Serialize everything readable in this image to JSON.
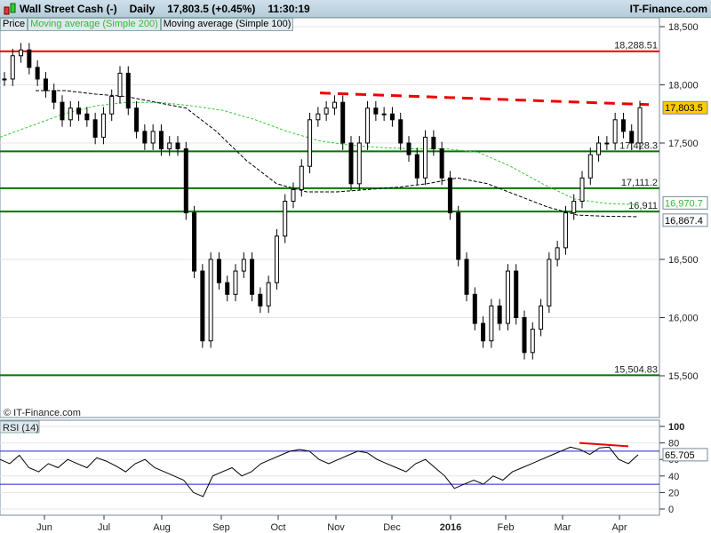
{
  "header": {
    "title": "Wall Street Cash (-)",
    "period": "Daily",
    "price": "17,803.5 (+0.45%)",
    "time": "11:30:19",
    "brand": "IT-Finance.com"
  },
  "legend": [
    "Price",
    "Moving average (Simple 200)",
    "Moving average (Simple 100)"
  ],
  "copyright": "© IT-Finance.com",
  "rsi_label": "RSI (14)",
  "colors": {
    "up": "#ffffff",
    "down": "#000000",
    "ma200": "#33cc33",
    "ma100": "#000000",
    "support": "#007700",
    "resistance": "#ee0000",
    "rsi_band": "#2222cc",
    "last": "#ffcc00"
  },
  "chart_data": [
    {
      "type": "candlestick",
      "title": "Wall Street Cash (-) Daily",
      "ylim": [
        15000,
        18600
      ],
      "yticks": [
        "18,500",
        "18,000",
        "17,500",
        "16,500",
        "16,000",
        "15,500"
      ],
      "ytick_values": [
        18500,
        18000,
        17500,
        16500,
        16000,
        15500
      ],
      "xticks": [
        "Jun",
        "Jul",
        "Aug",
        "Sep",
        "Oct",
        "Nov",
        "Dec",
        "2016",
        "Feb",
        "Mar",
        "Apr"
      ],
      "close": [
        18050,
        18250,
        18300,
        18150,
        18050,
        17950,
        17850,
        17700,
        17800,
        17750,
        17700,
        17550,
        17750,
        17900,
        18100,
        17800,
        17600,
        17500,
        17600,
        17450,
        17500,
        17450,
        16900,
        16400,
        15800,
        16500,
        16300,
        16200,
        16400,
        16500,
        16200,
        16100,
        16300,
        16700,
        17000,
        17100,
        17300,
        17700,
        17750,
        17800,
        17850,
        17500,
        17150,
        17500,
        17800,
        17750,
        17750,
        17700,
        17500,
        17400,
        17200,
        17550,
        17450,
        17200,
        16900,
        16500,
        16200,
        15950,
        15800,
        16100,
        15950,
        16400,
        16000,
        15700,
        15900,
        16100,
        16500,
        16600,
        16900,
        17000,
        17200,
        17400,
        17500,
        17500,
        17700,
        17600,
        17500,
        17803.5
      ],
      "ma200": [
        17550,
        17650,
        17750,
        17820,
        17850,
        17850,
        17820,
        17780,
        17700,
        17600,
        17520,
        17480,
        17460,
        17450,
        17450,
        17420,
        17300,
        17150,
        17020,
        16980,
        16970.7
      ],
      "ma100": [
        17950,
        17950,
        17920,
        17900,
        17850,
        17800,
        17600,
        17350,
        17150,
        17080,
        17080,
        17100,
        17120,
        17150,
        17200,
        17150,
        17050,
        16950,
        16880,
        16870,
        16867.4
      ],
      "levels": [
        {
          "value": 18288.51,
          "label": "18,288.51",
          "kind": "resistance"
        },
        {
          "value": 17428.3,
          "label": "17,428.3",
          "kind": "support"
        },
        {
          "value": 17111.2,
          "label": "17,111.2",
          "kind": "support"
        },
        {
          "value": 16911,
          "label": "16,911",
          "kind": "support"
        },
        {
          "value": 15504.83,
          "label": "15,504.83",
          "kind": "support"
        }
      ],
      "trendline": [
        17930,
        17830
      ],
      "last_labels": {
        "price": "17,803.5",
        "ma200": "16,970.7",
        "ma100": "16,867.4"
      }
    },
    {
      "type": "line",
      "title": "RSI (14)",
      "ylim": [
        0,
        100
      ],
      "yticks": [
        "100",
        "80",
        "60",
        "40",
        "20",
        "0"
      ],
      "ytick_values": [
        100,
        80,
        60,
        40,
        20,
        0
      ],
      "bands": [
        70,
        30
      ],
      "values": [
        60,
        55,
        65,
        50,
        45,
        55,
        50,
        60,
        55,
        50,
        62,
        58,
        52,
        45,
        55,
        60,
        50,
        45,
        40,
        35,
        20,
        15,
        40,
        45,
        50,
        40,
        45,
        55,
        60,
        65,
        70,
        72,
        70,
        60,
        55,
        60,
        65,
        70,
        68,
        60,
        55,
        50,
        45,
        55,
        60,
        50,
        40,
        25,
        30,
        35,
        30,
        40,
        35,
        45,
        50,
        55,
        60,
        65,
        70,
        75,
        72,
        66,
        74,
        75,
        60,
        55,
        65.705
      ],
      "trendline": [
        80,
        76
      ],
      "last_label": "65.705"
    }
  ]
}
